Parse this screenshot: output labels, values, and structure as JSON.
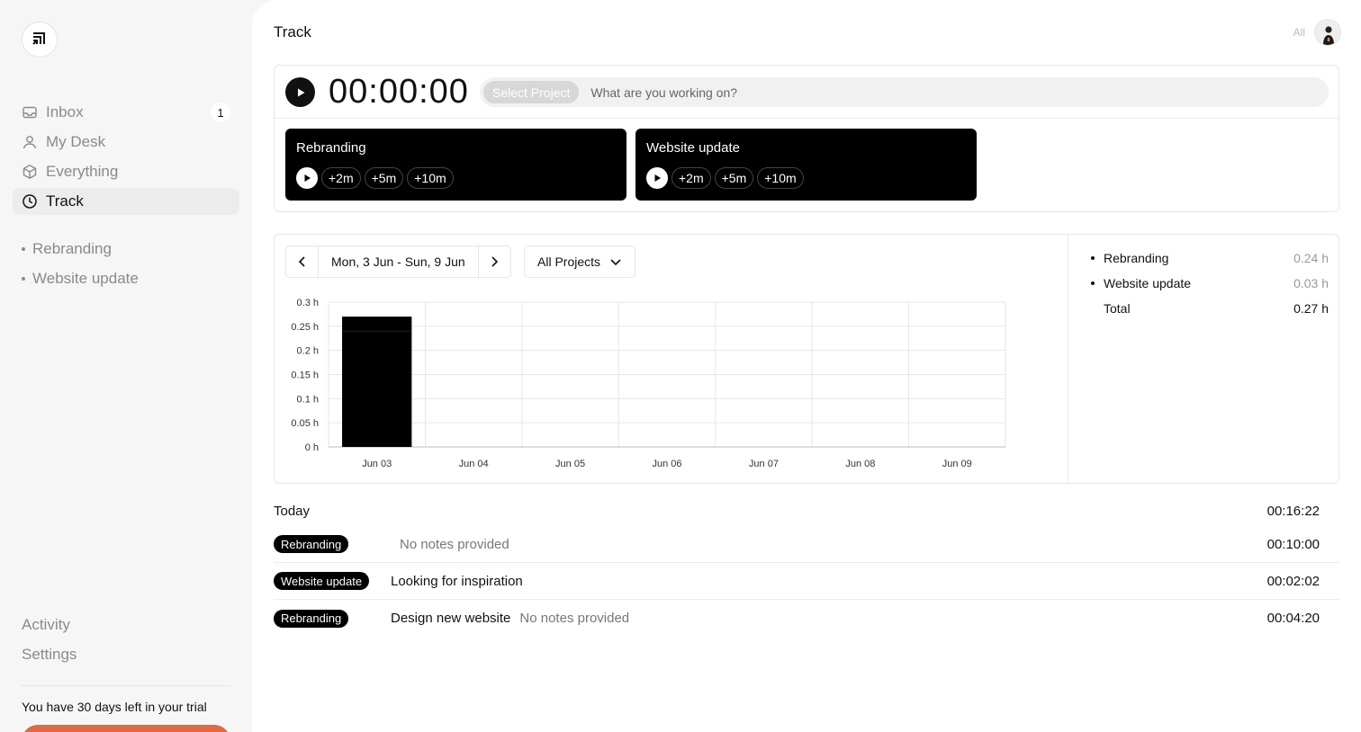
{
  "sidebar": {
    "nav": [
      {
        "label": "Inbox",
        "count": "1"
      },
      {
        "label": "My Desk"
      },
      {
        "label": "Everything"
      },
      {
        "label": "Track"
      }
    ],
    "projects": [
      "Rebranding",
      "Website update"
    ],
    "bottom": [
      "Activity",
      "Settings"
    ],
    "trial_text": "You have 30 days left in your trial"
  },
  "header": {
    "title": "Track",
    "filter": "All"
  },
  "timer": {
    "value": "00:00:00",
    "select_project": "Select Project",
    "placeholder": "What are you working on?"
  },
  "quick": [
    {
      "name": "Rebranding",
      "buttons": [
        "+2m",
        "+5m",
        "+10m"
      ]
    },
    {
      "name": "Website update",
      "buttons": [
        "+2m",
        "+5m",
        "+10m"
      ]
    }
  ],
  "chart_controls": {
    "date_range": "Mon, 3 Jun - Sun, 9 Jun",
    "project_filter": "All Projects"
  },
  "chart_data": {
    "type": "bar",
    "categories": [
      "Jun 03",
      "Jun 04",
      "Jun 05",
      "Jun 06",
      "Jun 07",
      "Jun 08",
      "Jun 09"
    ],
    "series": [
      {
        "values": [
          0.24,
          0,
          0,
          0,
          0,
          0,
          0
        ],
        "color": "#000000"
      },
      {
        "values": [
          0.03,
          0,
          0,
          0,
          0,
          0,
          0
        ],
        "color": "#000000"
      }
    ],
    "stacked": true,
    "yticks": [
      "0 h",
      "0.05 h",
      "0.1 h",
      "0.15 h",
      "0.2 h",
      "0.25 h",
      "0.3 h"
    ],
    "ylim": [
      0,
      0.3
    ],
    "grid": true
  },
  "legend": {
    "rows": [
      {
        "name": "Rebranding",
        "value": "0.24 h"
      },
      {
        "name": "Website update",
        "value": "0.03 h"
      }
    ],
    "total_label": "Total",
    "total_value": "0.27 h"
  },
  "today": {
    "label": "Today",
    "total": "00:16:22",
    "entries": [
      {
        "project": "Rebranding",
        "description": "",
        "note": "No notes provided",
        "time": "00:10:00"
      },
      {
        "project": "Website update",
        "description": "Looking for inspiration",
        "note": "",
        "time": "00:02:02"
      },
      {
        "project": "Rebranding",
        "description": "Design new website",
        "note": "No notes provided",
        "time": "00:04:20"
      }
    ]
  },
  "colors": {
    "accent": "#e06a45",
    "bar": "#000000"
  }
}
